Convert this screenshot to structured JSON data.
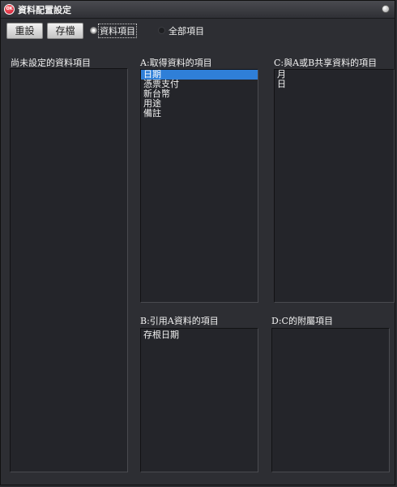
{
  "window": {
    "title": "資料配置設定",
    "icon_text": "OK"
  },
  "toolbar": {
    "reset_label": "重設",
    "save_label": "存檔",
    "radio_data_items": "資料項目",
    "radio_all_items": "全部項目",
    "selected_radio": "資料項目"
  },
  "panels": {
    "unassigned": {
      "label": "尚未設定的資料項目",
      "items": []
    },
    "a": {
      "label": "A:取得資料的項目",
      "items": [
        "日期",
        "憑票支付",
        "新台幣",
        "用途",
        "備註"
      ],
      "selected": "日期"
    },
    "c": {
      "label": "C:與A或B共享資料的項目",
      "items": [
        "月",
        "日"
      ]
    },
    "b": {
      "label": "B:引用A資料的項目",
      "items": [
        "存根日期"
      ]
    },
    "d": {
      "label": "D:C的附屬項目",
      "items": []
    }
  }
}
